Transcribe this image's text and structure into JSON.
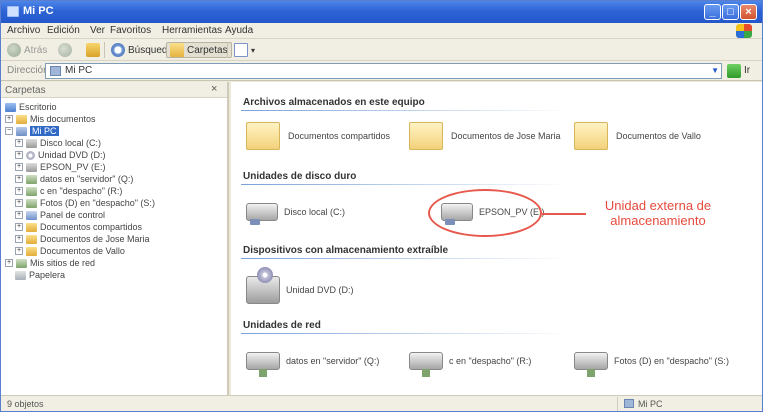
{
  "window": {
    "title": "Mi PC"
  },
  "menu": [
    "Archivo",
    "Edición",
    "Ver",
    "Favoritos",
    "Herramientas",
    "Ayuda"
  ],
  "toolbar": {
    "back": "Atrás",
    "search": "Búsqueda",
    "folders": "Carpetas"
  },
  "address": {
    "label": "Dirección",
    "value": "Mi PC",
    "go": "Ir"
  },
  "folders_pane": {
    "title": "Carpetas",
    "close": "×",
    "items": [
      "Escritorio",
      "Mis documentos",
      "Mi PC",
      "Disco local (C:)",
      "Unidad DVD (D:)",
      "EPSON_PV (E:)",
      "datos en \"servidor\" (Q:)",
      "c en \"despacho\" (R:)",
      "Fotos (D) en \"despacho\" (S:)",
      "Panel de control",
      "Documentos compartidos",
      "Documentos de Jose Maria",
      "Documentos de Vallo",
      "Mis sitios de red",
      "Papelera"
    ]
  },
  "content": {
    "sections": {
      "stored": "Archivos almacenados en este equipo",
      "hard": "Unidades de disco duro",
      "removable": "Dispositivos con almacenamiento extraíble",
      "network": "Unidades de red"
    },
    "stored_items": [
      "Documentos compartidos",
      "Documentos de Jose Maria",
      "Documentos de Vallo"
    ],
    "hard_items": [
      "Disco local (C:)",
      "EPSON_PV (E:)"
    ],
    "removable_items": [
      "Unidad DVD (D:)"
    ],
    "network_items": [
      "datos en \"servidor\" (Q:)",
      "c en \"despacho\" (R:)",
      "Fotos (D) en \"despacho\" (S:)"
    ]
  },
  "annotation": {
    "text": "Unidad externa de almacenamiento",
    "color": "#e64a3d"
  },
  "status": {
    "left": "9 objetos",
    "right": "Mi PC"
  }
}
